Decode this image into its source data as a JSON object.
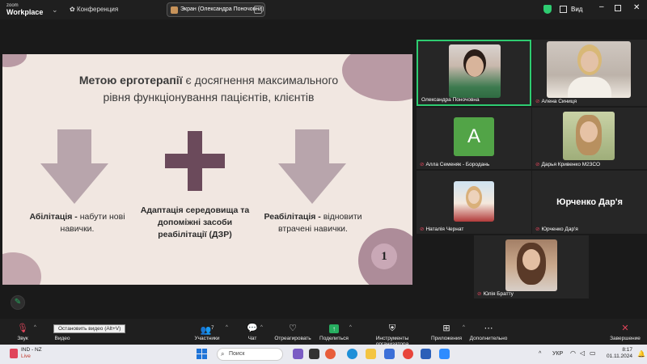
{
  "topbar": {
    "brand_line1": "zoom",
    "brand_line2": "Workplace",
    "conference_label": "Конференция",
    "share_label": "Экран (Олександра Поночовна)",
    "view_label": "Вид"
  },
  "slide": {
    "title_bold": "Метою ерготерапії",
    "title_rest": " є досягнення максимального рівня функціонування пацієнтів, клієнтів",
    "left_bold": "Абілітація -",
    "left_rest": " набути нові навички.",
    "center_text": "Адаптація середовища та допоміжні засоби реабілітації (ДЗР)",
    "right_bold": "Реабілітація -",
    "right_rest": " відновити втрачені навички.",
    "page_number": "1"
  },
  "participants": [
    {
      "name": "Олександра Поночовна",
      "muted": false
    },
    {
      "name": "Алена Синиця",
      "muted": true
    },
    {
      "name": "Алла Семеняк - Бородань",
      "muted": true,
      "initial": "A"
    },
    {
      "name": "Дарья Кривенко М23СО",
      "muted": true
    },
    {
      "name": "Наталія Чернат",
      "muted": true
    },
    {
      "name": "Юрченко Дар'я",
      "muted": true,
      "display_name": "Юрченко Дар'я"
    },
    {
      "name": "Юлія Братту",
      "muted": true
    }
  ],
  "toolbar": {
    "audio": "Звук",
    "video": "Видео",
    "video_tooltip": "Остановить видео (Alt+V)",
    "participants": "Участники",
    "participants_count": "7",
    "chat": "Чат",
    "react": "Отреагировать",
    "share": "Поделиться",
    "host_tools": "Инструменты организатора",
    "apps": "Приложения",
    "more": "Дополнительно",
    "end": "Завершение"
  },
  "taskbar": {
    "market": "IND - NZ",
    "market_status": "Live",
    "search_placeholder": "Поиск",
    "lang": "УКР",
    "time": "8:17",
    "date": "01.11.2024"
  },
  "colors": {
    "accent_green": "#2ecc71",
    "muted_red": "#e0455b",
    "slide_bg": "#f1e7e1",
    "plus_color": "#6b4a5b",
    "arrow_color": "#b8a5ac",
    "active_speaker_border": "#2ecc71"
  }
}
